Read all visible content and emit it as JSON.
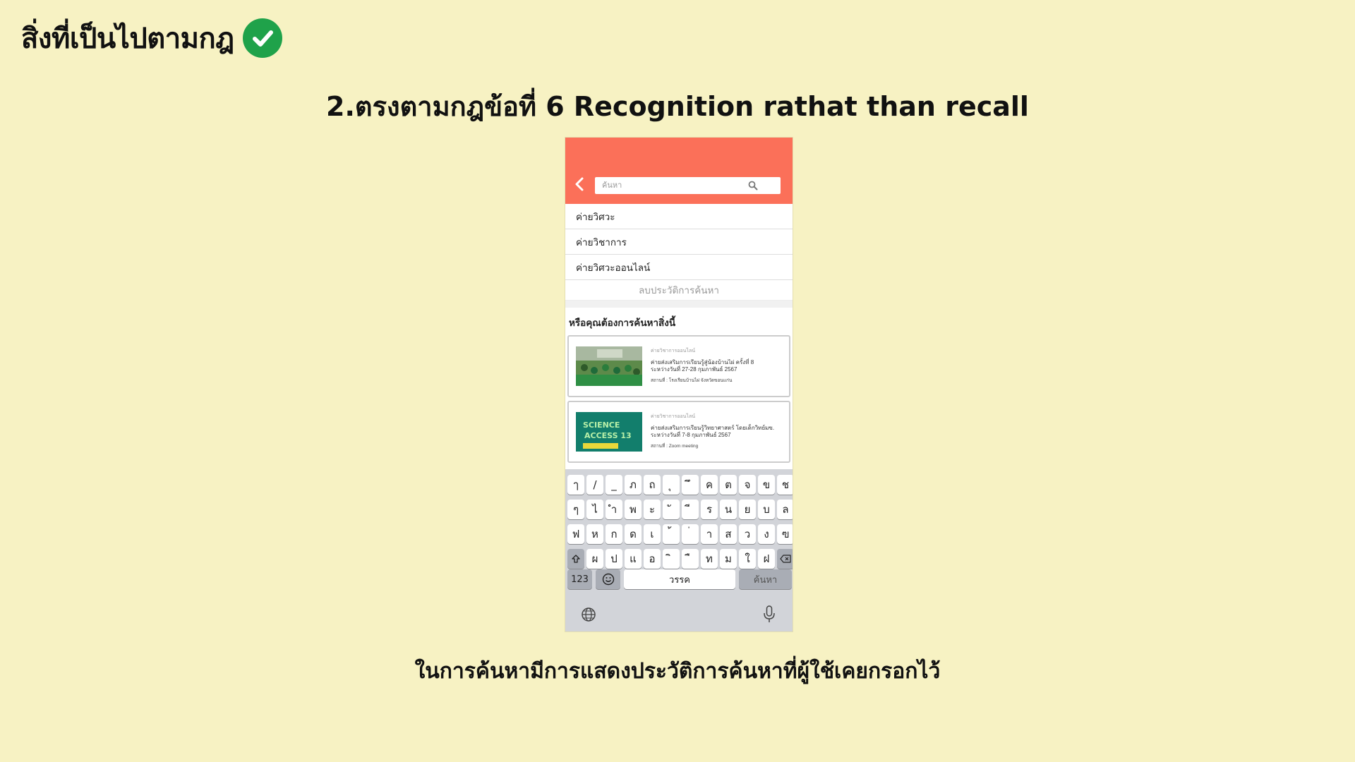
{
  "heading": {
    "title": "สิ่งที่เป็นไปตามกฎ"
  },
  "subtitle": "2.ตรงตามกฎข้อที่ 6 Recognition rathat than recall",
  "caption": "ในการค้นหามีการแสดงประวัติการค้นหาที่ผู้ใช้เคยกรอกไว้",
  "colors": {
    "background": "#f7f2c3",
    "topbar": "#fb7059",
    "check": "#1fa24a"
  },
  "phone": {
    "search": {
      "placeholder": "ค้นหา",
      "value": ""
    },
    "history": [
      "ค่ายวิศวะ",
      "ค่ายวิชาการ",
      "ค่ายวิศวะออนไลน์"
    ],
    "clear_history": "ลบประวัติการค้นหา",
    "suggest_title": "หรือคุณต้องการค้นหาสิ่งนี้",
    "cards": [
      {
        "category": "ค่ายวิชาการออนไลน์",
        "title": "ค่ายส่งเสริมการเรียนรู้สู่น้องบ้านไผ่ ครั้งที่ 8",
        "date": "ระหว่างวันที่ 27-28 กุมภาพันธ์ 2567",
        "place": "สถานที่ : โรงเรียนบ้านไผ่ จังหวัดขอนแก่น"
      },
      {
        "category": "ค่ายวิชาการออนไลน์",
        "title": "ค่ายส่งเสริมการเรียนรู้วิทยาศาสตร์ โดยเด็กวิทย์มข.",
        "date": "ระหว่างวันที่ 7-8 กุมภาพันธ์ 2567",
        "place": "สถานที่ : Zoom meeting",
        "thumb_text": "SCIENCE ACCESS 13"
      }
    ],
    "keyboard": {
      "row1": [
        "ๅ",
        "/",
        "_",
        "ภ",
        "ถ",
        "ุ",
        "ึ",
        "ค",
        "ต",
        "จ",
        "ข",
        "ช"
      ],
      "row2": [
        "ๆ",
        "ไ",
        "ำ",
        "พ",
        "ะ",
        "ั",
        "ี",
        "ร",
        "น",
        "ย",
        "บ",
        "ล"
      ],
      "row3": [
        "ฟ",
        "ห",
        "ก",
        "ด",
        "เ",
        "้",
        "่",
        "า",
        "ส",
        "ว",
        "ง",
        "ฃ"
      ],
      "row4": [
        "ผ",
        "ป",
        "แ",
        "อ",
        "ิ",
        "ื",
        "ท",
        "ม",
        "ใ",
        "ฝ"
      ],
      "num_label": "123",
      "space_label": "วรรค",
      "search_label": "ค้นหา"
    }
  }
}
